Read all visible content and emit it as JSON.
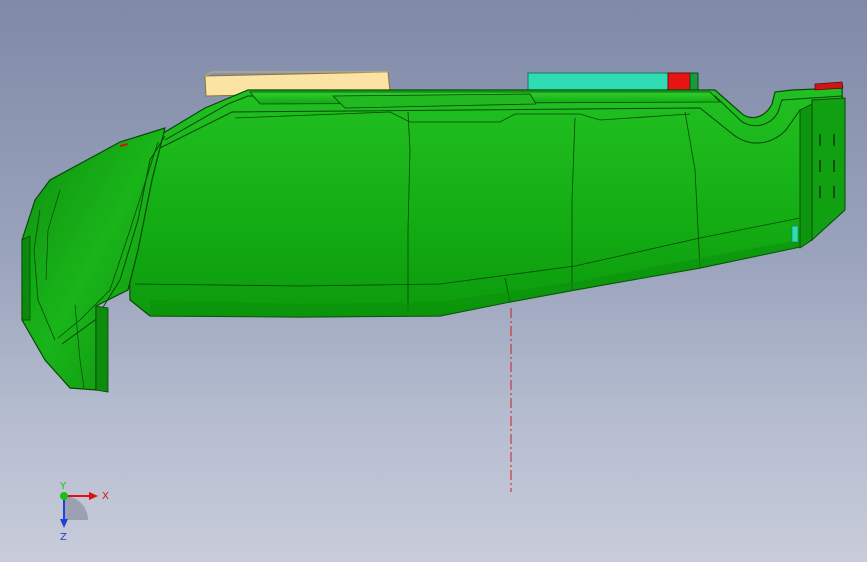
{
  "viewport": {
    "background_top": "#7f8aa7",
    "background_bottom": "#c8ccda"
  },
  "model": {
    "body_color": "#17b117",
    "body_shadow": "#0a8a0a",
    "edge_color": "#064806",
    "tan_block_color": "#fbe3a3",
    "teal_block_color": "#2fdcb4",
    "red_block_color": "#e81414",
    "centerline_color": "#cc1f1f"
  },
  "triad": {
    "x_label": "X",
    "y_label": "Y",
    "z_label": "Z",
    "x_color": "#e01010",
    "y_color": "#18c018",
    "z_color": "#2040d8"
  }
}
